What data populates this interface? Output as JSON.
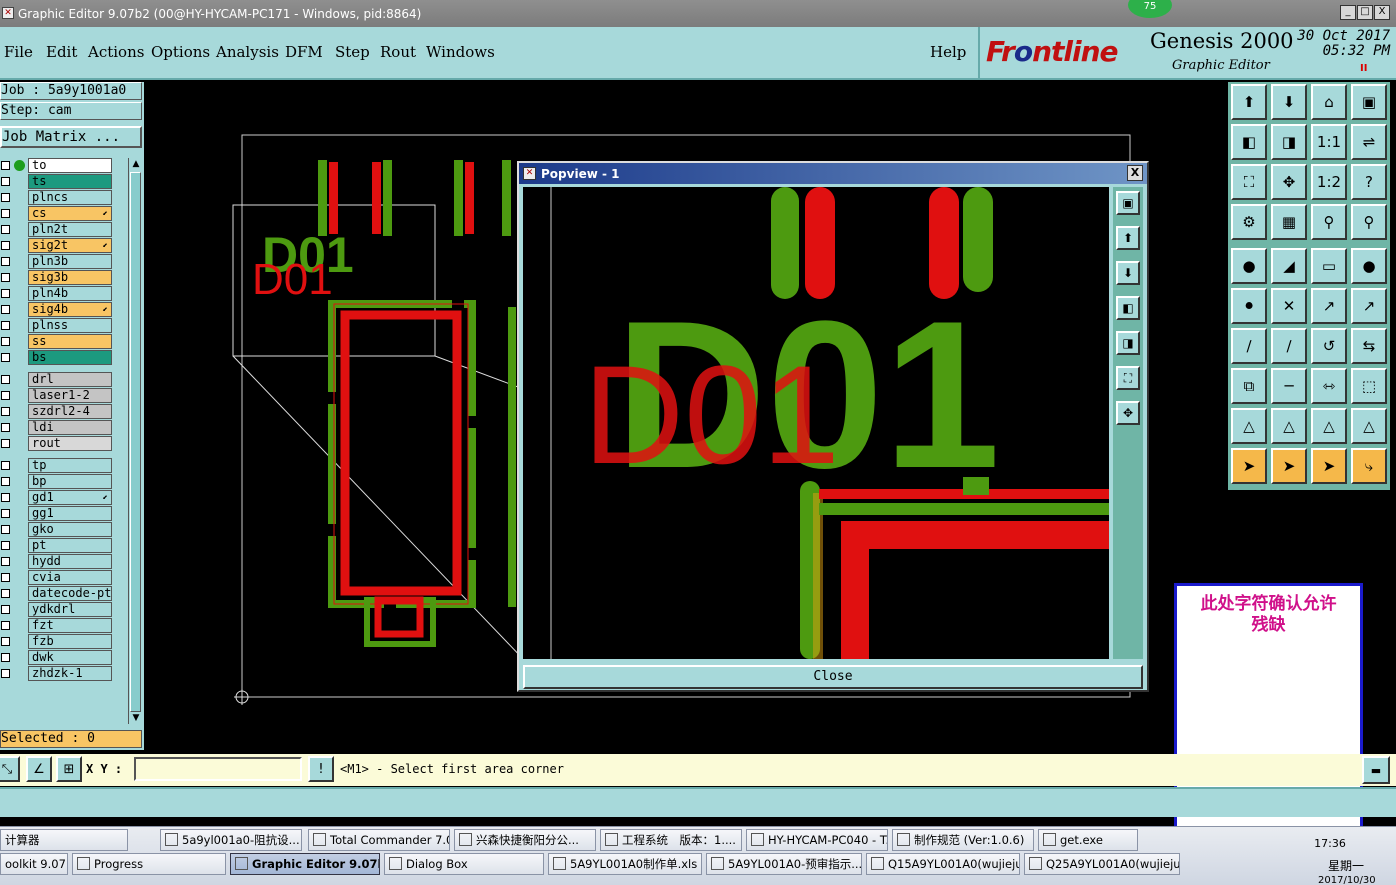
{
  "window": {
    "title": "Graphic Editor 9.07b2 (00@HY-HYCAM-PC171 - Windows, pid:8864)",
    "badge": "75",
    "min": "_",
    "max": "□",
    "close": "X"
  },
  "menu": {
    "items": [
      "File",
      "Edit",
      "Actions",
      "Options",
      "Analysis",
      "DFM",
      "Step",
      "Rout",
      "Windows"
    ],
    "help": "Help"
  },
  "brand": {
    "logo_left": "Fr",
    "logo_o": "o",
    "logo_right": "ntline",
    "product": "Genesis 2000",
    "subtitle": "Graphic Editor",
    "date": "30 Oct 2017",
    "time": "05:32 PM",
    "pause": "II"
  },
  "left": {
    "job": "Job : 5a9y1001a0",
    "step": "Step: cam",
    "job_matrix": "Job Matrix ...",
    "selected": "Selected : 0",
    "layers": [
      {
        "name": "to",
        "color": "#ffffff",
        "dot": true,
        "flag": ""
      },
      {
        "name": "ts",
        "color": "#1c9a7f",
        "dot": false,
        "flag": ""
      },
      {
        "name": "plncs",
        "color": "#a7d9da",
        "dot": false,
        "flag": ""
      },
      {
        "name": "cs",
        "color": "#f8c564",
        "dot": false,
        "flag": "⬋"
      },
      {
        "name": "pln2t",
        "color": "#a7d9da",
        "dot": false,
        "flag": ""
      },
      {
        "name": "sig2t",
        "color": "#f8c564",
        "dot": false,
        "flag": "⬋"
      },
      {
        "name": "pln3b",
        "color": "#a7d9da",
        "dot": false,
        "flag": ""
      },
      {
        "name": "sig3b",
        "color": "#f8c564",
        "dot": false,
        "flag": ""
      },
      {
        "name": "pln4b",
        "color": "#a7d9da",
        "dot": false,
        "flag": ""
      },
      {
        "name": "sig4b",
        "color": "#f8c564",
        "dot": false,
        "flag": "⬋"
      },
      {
        "name": "plnss",
        "color": "#a7d9da",
        "dot": false,
        "flag": ""
      },
      {
        "name": "ss",
        "color": "#f8c564",
        "dot": false,
        "flag": ""
      },
      {
        "name": "bs",
        "color": "#1c9a7f",
        "dot": false,
        "flag": ""
      },
      {
        "name": "drl",
        "color": "#c4c4c4",
        "dot": false,
        "flag": ""
      },
      {
        "name": "laser1-2",
        "color": "#c4c4c4",
        "dot": false,
        "flag": ""
      },
      {
        "name": "szdrl2-4",
        "color": "#c4c4c4",
        "dot": false,
        "flag": ""
      },
      {
        "name": "ldi",
        "color": "#c4c4c4",
        "dot": false,
        "flag": ""
      },
      {
        "name": "rout",
        "color": "#d8d8d8",
        "dot": false,
        "flag": ""
      },
      {
        "name": "tp",
        "color": "#a7d9da",
        "dot": false,
        "flag": ""
      },
      {
        "name": "bp",
        "color": "#a7d9da",
        "dot": false,
        "flag": ""
      },
      {
        "name": "gd1",
        "color": "#a7d9da",
        "dot": false,
        "flag": "⬋"
      },
      {
        "name": "gg1",
        "color": "#a7d9da",
        "dot": false,
        "flag": ""
      },
      {
        "name": "gko",
        "color": "#a7d9da",
        "dot": false,
        "flag": ""
      },
      {
        "name": "pt",
        "color": "#a7d9da",
        "dot": false,
        "flag": ""
      },
      {
        "name": "hydd",
        "color": "#a7d9da",
        "dot": false,
        "flag": ""
      },
      {
        "name": "cvia",
        "color": "#a7d9da",
        "dot": false,
        "flag": ""
      },
      {
        "name": "datecode-ptc",
        "color": "#a7d9da",
        "dot": false,
        "flag": ""
      },
      {
        "name": "ydkdrl",
        "color": "#a7d9da",
        "dot": false,
        "flag": ""
      },
      {
        "name": "fzt",
        "color": "#a7d9da",
        "dot": false,
        "flag": ""
      },
      {
        "name": "fzb",
        "color": "#a7d9da",
        "dot": false,
        "flag": ""
      },
      {
        "name": "dwk",
        "color": "#a7d9da",
        "dot": false,
        "flag": ""
      },
      {
        "name": "zhdzk-1",
        "color": "#a7d9da",
        "dot": false,
        "flag": ""
      }
    ]
  },
  "canvas_text": {
    "main_label": "D01",
    "popview_label": "D01"
  },
  "toolbar_icons": [
    "layer-up-icon",
    "layer-down-icon",
    "home-icon",
    "window-icon",
    "pan-left-icon",
    "pan-right-icon",
    "one-to-one-icon",
    "redraw-icon",
    "fit-icon",
    "center-icon",
    "ratio-icon",
    "help-icon",
    "measure-icon",
    "grid-icon",
    "snap-icon",
    "snap-alt-icon",
    "pad-add-icon",
    "line-add-icon",
    "ruler-icon",
    "circle-fill-icon",
    "node-move-icon",
    "node-delete-icon",
    "arc-icon",
    "arc-alt-icon",
    "line-draw-icon",
    "line-edit-icon",
    "rotate-icon",
    "mirror-icon",
    "copy-icon",
    "line-split-icon",
    "resize-icon",
    "shapes-icon",
    "triangle-icon",
    "triangle-select-icon",
    "triangle-blue-icon",
    "triangle-mark-icon",
    "select-icon",
    "select-box-icon",
    "select-circle-icon",
    "select-route-icon"
  ],
  "toolbar_labels": {
    "one_to_one": "1:1",
    "ratio": "1:2",
    "help": "?"
  },
  "popview": {
    "title": "Popview - 1",
    "close_x": "X",
    "close_button": "Close"
  },
  "note": {
    "line1": "此处字符确认允许",
    "line2": "残缺"
  },
  "status": {
    "xy_label": "X Y :",
    "xy_value": "",
    "message": "<M1> - Select first area corner",
    "info_icon": "!"
  },
  "taskbar": {
    "row1": [
      "计算器",
      "5a9yl001a0-阻抗设...",
      "Total Commander 7.0...",
      "兴森快捷衡阳分公...",
      "工程系统　版本：1....",
      "HY-HYCAM-PC040 - T...",
      "制作规范 (Ver:1.0.6)",
      "get.exe"
    ],
    "row2": [
      "oolkit 9.07...",
      "Progress",
      "Graphic Editor 9.07b2...",
      "Dialog Box",
      "5A9YL001A0制作单.xls ...",
      "5A9YL001A0-预审指示....",
      "Q15A9YL001A0(wujiejun....",
      "Q25A9YL001A0(wujieju..."
    ],
    "time": "17:36",
    "day": "星期一",
    "date": "2017/10/30"
  }
}
